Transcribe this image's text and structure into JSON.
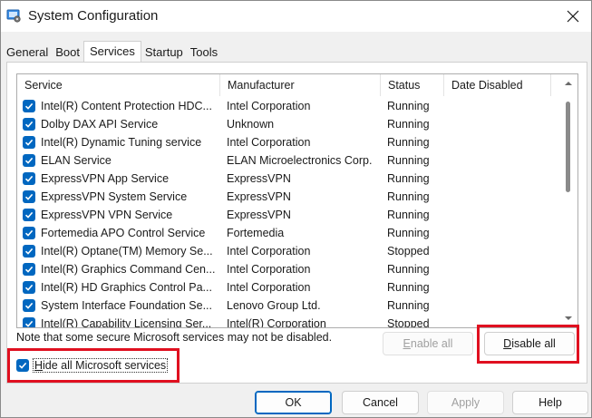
{
  "window": {
    "title": "System Configuration"
  },
  "tabs": [
    "General",
    "Boot",
    "Services",
    "Startup",
    "Tools"
  ],
  "active_tab": "Services",
  "columns": [
    "Service",
    "Manufacturer",
    "Status",
    "Date Disabled"
  ],
  "services": [
    {
      "name": "Intel(R) Content Protection HDC...",
      "manufacturer": "Intel Corporation",
      "status": "Running"
    },
    {
      "name": "Dolby DAX API Service",
      "manufacturer": "Unknown",
      "status": "Running"
    },
    {
      "name": "Intel(R) Dynamic Tuning service",
      "manufacturer": "Intel Corporation",
      "status": "Running"
    },
    {
      "name": "ELAN Service",
      "manufacturer": "ELAN Microelectronics Corp.",
      "status": "Running"
    },
    {
      "name": "ExpressVPN App Service",
      "manufacturer": "ExpressVPN",
      "status": "Running"
    },
    {
      "name": "ExpressVPN System Service",
      "manufacturer": "ExpressVPN",
      "status": "Running"
    },
    {
      "name": "ExpressVPN VPN Service",
      "manufacturer": "ExpressVPN",
      "status": "Running"
    },
    {
      "name": "Fortemedia APO Control Service",
      "manufacturer": "Fortemedia",
      "status": "Running"
    },
    {
      "name": "Intel(R) Optane(TM) Memory Se...",
      "manufacturer": "Intel Corporation",
      "status": "Stopped"
    },
    {
      "name": "Intel(R) Graphics Command Cen...",
      "manufacturer": "Intel Corporation",
      "status": "Running"
    },
    {
      "name": "Intel(R) HD Graphics Control Pa...",
      "manufacturer": "Intel Corporation",
      "status": "Running"
    },
    {
      "name": "System Interface Foundation Se...",
      "manufacturer": "Lenovo Group Ltd.",
      "status": "Running"
    },
    {
      "name": "Intel(R) Capability Licensing Ser...",
      "manufacturer": "Intel(R) Corporation",
      "status": "Stopped"
    }
  ],
  "note": "Note that some secure Microsoft services may not be disabled.",
  "enable_all": {
    "prefix": "",
    "accel": "E",
    "rest": "nable all"
  },
  "disable_all": {
    "prefix": "",
    "accel": "D",
    "rest": "isable all"
  },
  "hide_ms": {
    "prefix": "",
    "accel": "H",
    "rest": "ide all Microsoft services",
    "checked": true
  },
  "buttons": {
    "ok": "OK",
    "cancel": "Cancel",
    "apply": "Apply",
    "help": "Help"
  },
  "colors": {
    "accent": "#0067c0",
    "highlight": "#e01020"
  }
}
